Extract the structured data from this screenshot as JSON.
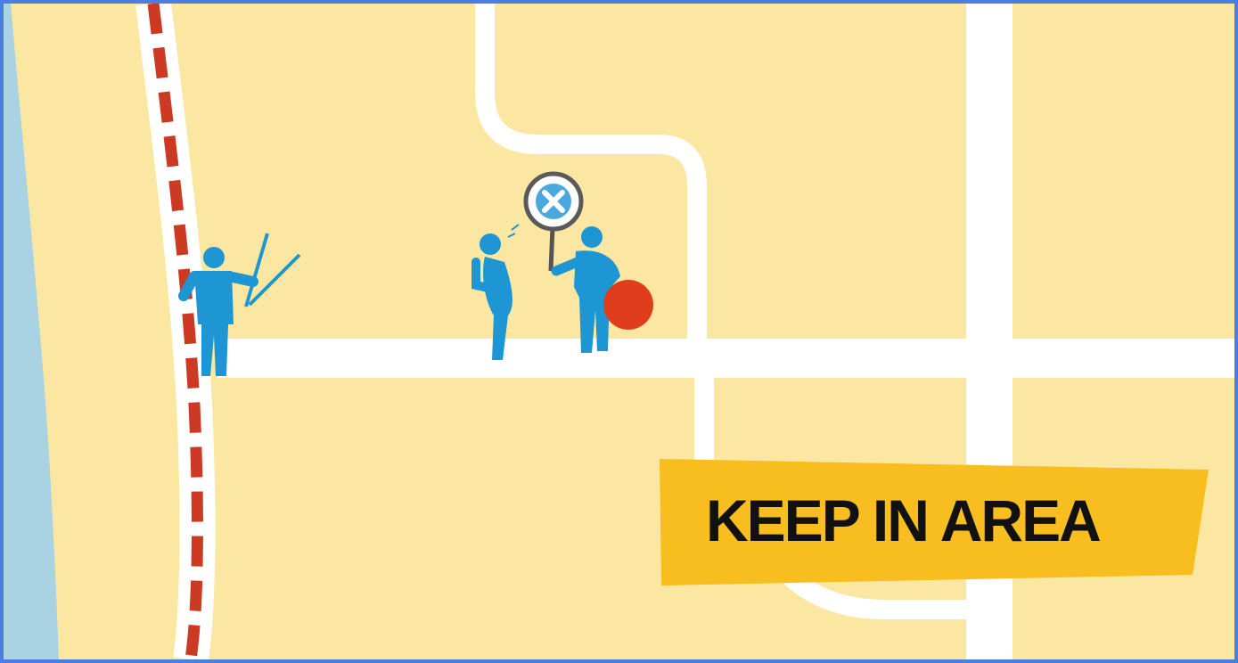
{
  "banner": {
    "label": "KEEP IN AREA"
  },
  "colors": {
    "land": "#fbe7a2",
    "road": "#ffffff",
    "water": "#a9d3e3",
    "boundary": "#cc3a24",
    "figure": "#1d96d3",
    "ball": "#e03d1c",
    "banner": "#f8bd1f",
    "frame": "#4a7fe0"
  },
  "icons": [
    "golfer-swinging-icon",
    "person-drinking-icon",
    "no-sign-icon",
    "person-holding-sign-icon",
    "ball-icon"
  ]
}
